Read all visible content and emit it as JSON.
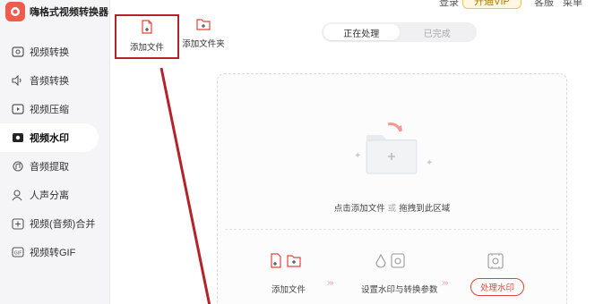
{
  "app": {
    "title": "嗨格式视频转换器"
  },
  "topbar": {
    "login": "登录",
    "vip": "开通VIP",
    "help": "客服",
    "menu": "菜单"
  },
  "sidebar": {
    "items": [
      {
        "label": "视频转换",
        "icon": "video-convert-icon"
      },
      {
        "label": "音频转换",
        "icon": "audio-convert-icon"
      },
      {
        "label": "视频压缩",
        "icon": "video-compress-icon"
      },
      {
        "label": "视频水印",
        "icon": "video-watermark-icon",
        "active": true
      },
      {
        "label": "音频提取",
        "icon": "audio-extract-icon"
      },
      {
        "label": "人声分离",
        "icon": "voice-separate-icon"
      },
      {
        "label": "视频(音频)合并",
        "icon": "merge-icon"
      },
      {
        "label": "视频转GIF",
        "icon": "gif-icon"
      }
    ]
  },
  "toolbar": {
    "add_file": "添加文件",
    "add_folder": "添加文件夹"
  },
  "tabs": [
    {
      "label": "正在处理",
      "active": true
    },
    {
      "label": "已完成",
      "active": false
    }
  ],
  "dropzone": {
    "hint_click": "点击添加文件",
    "hint_or": "或",
    "hint_drag": "拖拽到此区域"
  },
  "steps": {
    "step1": "添加文件",
    "step2": "设置水印与转换参数",
    "step3": "处理水印"
  },
  "colors": {
    "accent": "#e0453a",
    "annotation": "#b5232a",
    "sidebar_bg": "#f5f5f7"
  }
}
